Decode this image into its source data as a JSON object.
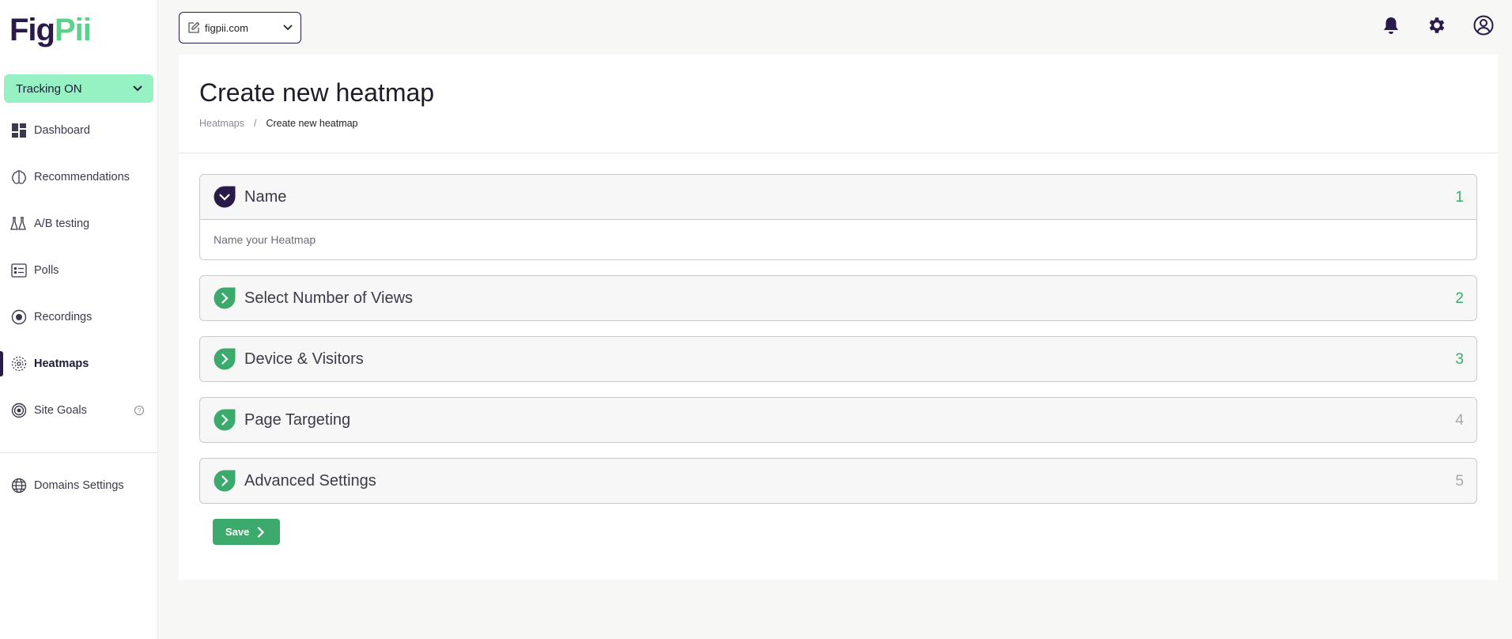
{
  "brand": {
    "logo_part1": "Fig",
    "logo_part2": "Pii"
  },
  "tracking": {
    "label": "Tracking ON"
  },
  "sidebar": {
    "items": [
      {
        "label": "Dashboard",
        "icon": "dashboard-icon"
      },
      {
        "label": "Recommendations",
        "icon": "brain-icon"
      },
      {
        "label": "A/B testing",
        "icon": "flasks-icon"
      },
      {
        "label": "Polls",
        "icon": "poll-icon"
      },
      {
        "label": "Recordings",
        "icon": "record-icon"
      },
      {
        "label": "Heatmaps",
        "icon": "heatmap-icon",
        "active": true
      },
      {
        "label": "Site Goals",
        "icon": "target-icon"
      },
      {
        "label": "Domains Settings",
        "icon": "globe-icon"
      }
    ],
    "help_glyph": "?"
  },
  "topbar": {
    "domain": "figpii.com"
  },
  "page": {
    "title": "Create new heatmap",
    "breadcrumb": {
      "parent": "Heatmaps",
      "separator": "/",
      "current": "Create new heatmap"
    }
  },
  "steps": [
    {
      "label": "Name",
      "number": "1",
      "placeholder": "Name your Heatmap"
    },
    {
      "label": "Select Number of Views",
      "number": "2"
    },
    {
      "label": "Device & Visitors",
      "number": "3"
    },
    {
      "label": "Page Targeting",
      "number": "4"
    },
    {
      "label": "Advanced Settings",
      "number": "5"
    }
  ],
  "actions": {
    "save_label": "Save"
  },
  "colors": {
    "brand_dark": "#2a1a4a",
    "brand_green": "#3daa6d",
    "tracking_bg": "#97f2c3"
  }
}
